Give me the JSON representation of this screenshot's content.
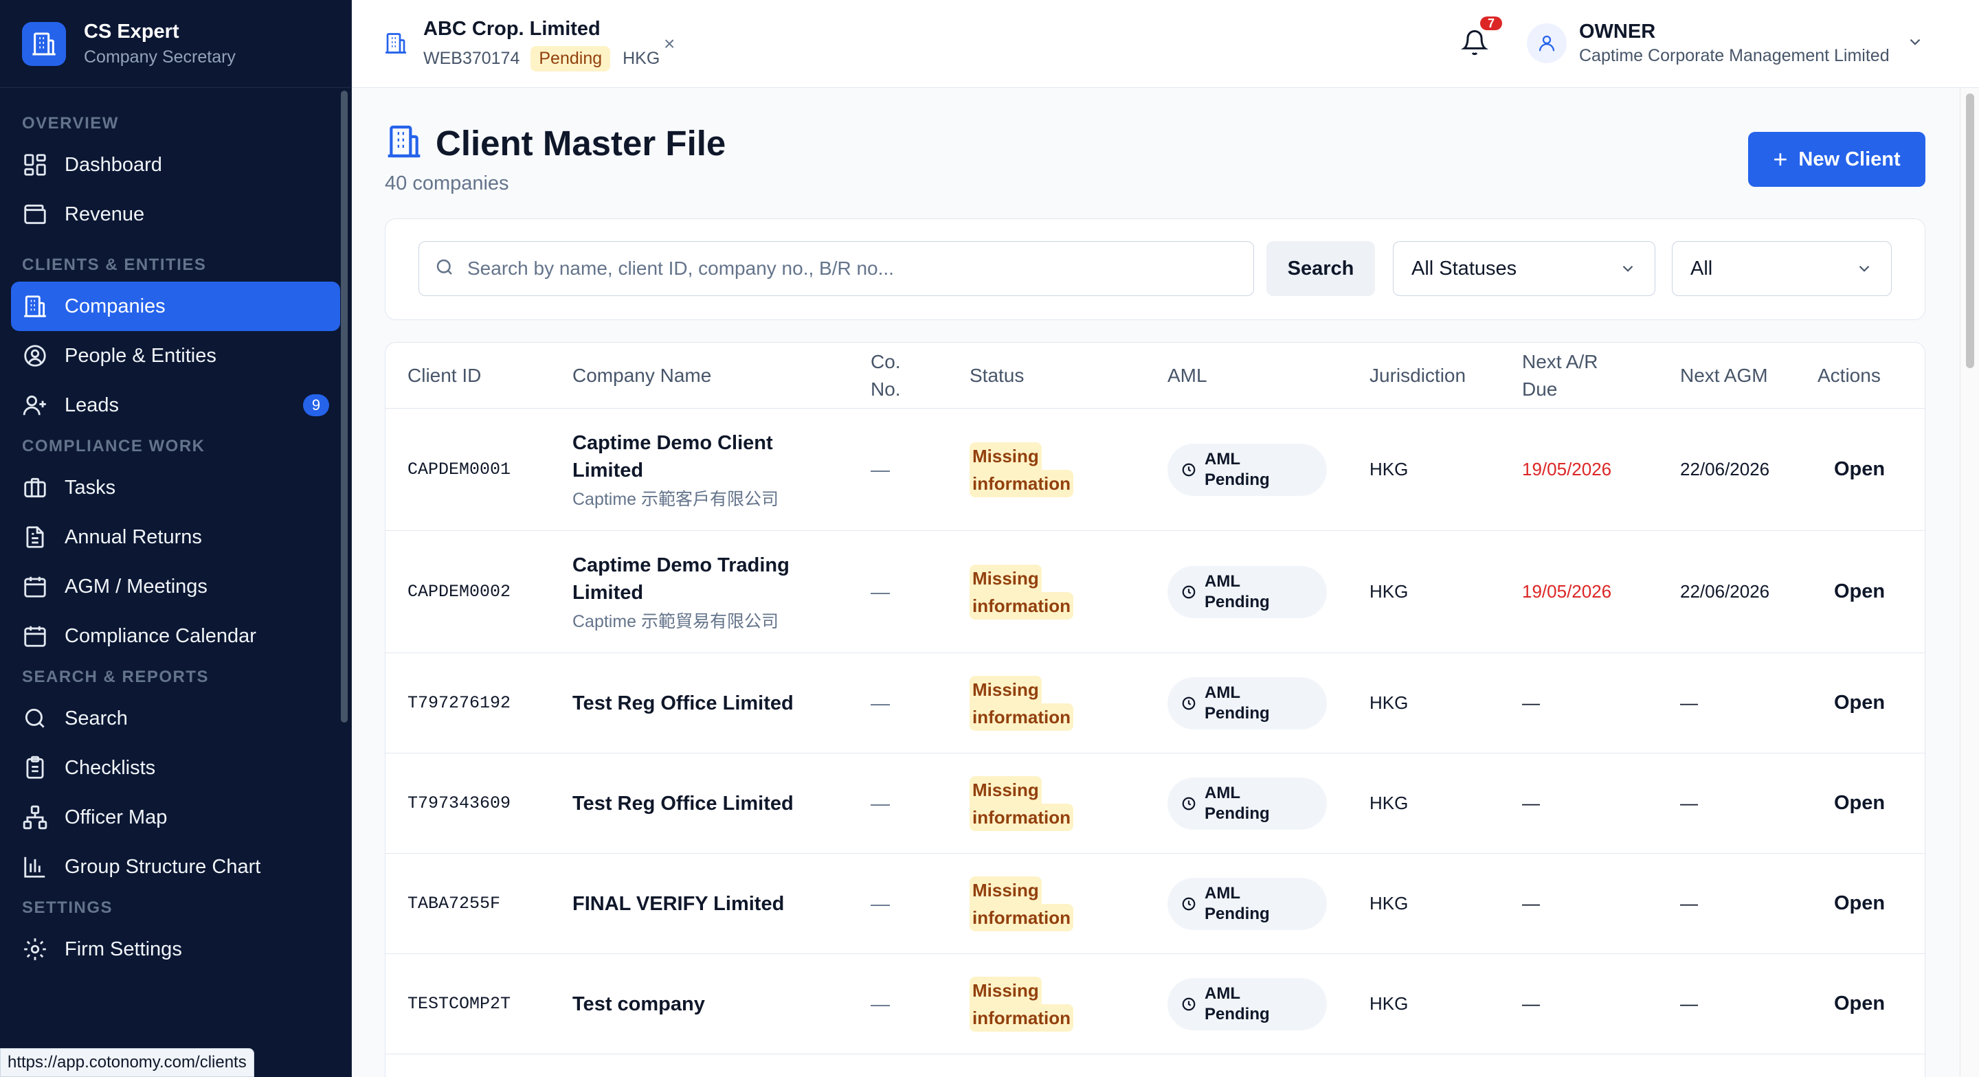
{
  "brand": {
    "title": "CS Expert",
    "subtitle": "Company Secretary"
  },
  "sidebar": {
    "sections": [
      {
        "label": "OVERVIEW",
        "items": [
          {
            "label": "Dashboard",
            "icon": "dashboard-icon"
          },
          {
            "label": "Revenue",
            "icon": "wallet-icon"
          }
        ]
      },
      {
        "label": "CLIENTS & ENTITIES",
        "items": [
          {
            "label": "Companies",
            "icon": "building-icon",
            "active": true
          },
          {
            "label": "People & Entities",
            "icon": "user-circle-icon"
          },
          {
            "label": "Leads",
            "icon": "user-plus-icon",
            "badge": "9"
          }
        ]
      },
      {
        "label": "COMPLIANCE WORK",
        "items": [
          {
            "label": "Tasks",
            "icon": "briefcase-icon"
          },
          {
            "label": "Annual Returns",
            "icon": "file-text-icon"
          },
          {
            "label": "AGM / Meetings",
            "icon": "calendar-icon"
          },
          {
            "label": "Compliance Calendar",
            "icon": "calendar-icon"
          }
        ]
      },
      {
        "label": "SEARCH & REPORTS",
        "items": [
          {
            "label": "Search",
            "icon": "search-icon"
          },
          {
            "label": "Checklists",
            "icon": "clipboard-icon"
          },
          {
            "label": "Officer Map",
            "icon": "network-icon"
          },
          {
            "label": "Group Structure Chart",
            "icon": "bar-chart-icon"
          }
        ]
      },
      {
        "label": "SETTINGS",
        "items": [
          {
            "label": "Firm Settings",
            "icon": "gear-icon"
          }
        ]
      }
    ]
  },
  "status_url": "https://app.cotonomy.com/clients",
  "topbar": {
    "company": {
      "name": "ABC Crop. Limited",
      "id": "WEB370174",
      "status": "Pending",
      "jurisdiction": "HKG",
      "close": "×"
    },
    "notifications": "7",
    "user": {
      "role": "OWNER",
      "org": "Captime Corporate Management Limited"
    }
  },
  "page": {
    "title": "Client Master File",
    "subtitle": "40 companies",
    "new_client_label": "New Client",
    "search_placeholder": "Search by name, client ID, company no., B/R no...",
    "search_button": "Search",
    "status_filter": "All Statuses",
    "second_filter": "All"
  },
  "table": {
    "headers": {
      "client_id": "Client ID",
      "company_name": "Company Name",
      "co_no_1": "Co.",
      "co_no_2": "No.",
      "status": "Status",
      "aml": "AML",
      "jurisdiction": "Jurisdiction",
      "next_ar_1": "Next A/R",
      "next_ar_2": "Due",
      "next_agm": "Next AGM",
      "actions": "Actions"
    },
    "rows": [
      {
        "client_id": "CAPDEM0001",
        "name_line1": "Captime Demo Client",
        "name_line2": "Limited",
        "name_alt": "Captime 示範客戶有限公司",
        "co_no": "—",
        "status_1": "Missing",
        "status_2": "information",
        "aml_1": "AML",
        "aml_2": "Pending",
        "jurisdiction": "HKG",
        "next_ar": "19/05/2026",
        "next_agm": "22/06/2026",
        "action": "Open"
      },
      {
        "client_id": "CAPDEM0002",
        "name_line1": "Captime Demo Trading",
        "name_line2": "Limited",
        "name_alt": "Captime 示範貿易有限公司",
        "co_no": "—",
        "status_1": "Missing",
        "status_2": "information",
        "aml_1": "AML",
        "aml_2": "Pending",
        "jurisdiction": "HKG",
        "next_ar": "19/05/2026",
        "next_agm": "22/06/2026",
        "action": "Open"
      },
      {
        "client_id": "T797276192",
        "name_line1": "Test Reg Office Limited",
        "co_no": "—",
        "status_1": "Missing",
        "status_2": "information",
        "aml_1": "AML",
        "aml_2": "Pending",
        "jurisdiction": "HKG",
        "next_ar": "—",
        "next_agm": "—",
        "action": "Open"
      },
      {
        "client_id": "T797343609",
        "name_line1": "Test Reg Office Limited",
        "co_no": "—",
        "status_1": "Missing",
        "status_2": "information",
        "aml_1": "AML",
        "aml_2": "Pending",
        "jurisdiction": "HKG",
        "next_ar": "—",
        "next_agm": "—",
        "action": "Open"
      },
      {
        "client_id": "TABA7255F",
        "name_line1": "FINAL VERIFY Limited",
        "co_no": "—",
        "status_1": "Missing",
        "status_2": "information",
        "aml_1": "AML",
        "aml_2": "Pending",
        "jurisdiction": "HKG",
        "next_ar": "—",
        "next_agm": "—",
        "action": "Open"
      },
      {
        "client_id": "TESTCOMP2T",
        "name_line1": "Test company",
        "co_no": "—",
        "status_1": "Missing",
        "status_2": "information",
        "aml_1": "AML",
        "aml_2": "Pending",
        "jurisdiction": "HKG",
        "next_ar": "—",
        "next_agm": "—",
        "action": "Open"
      }
    ]
  },
  "colors": {
    "sidebar_bg": "#0b1733",
    "accent": "#2563eb",
    "warning_bg": "#fef3c7",
    "warning_text": "#92400e",
    "danger": "#dc2626"
  }
}
